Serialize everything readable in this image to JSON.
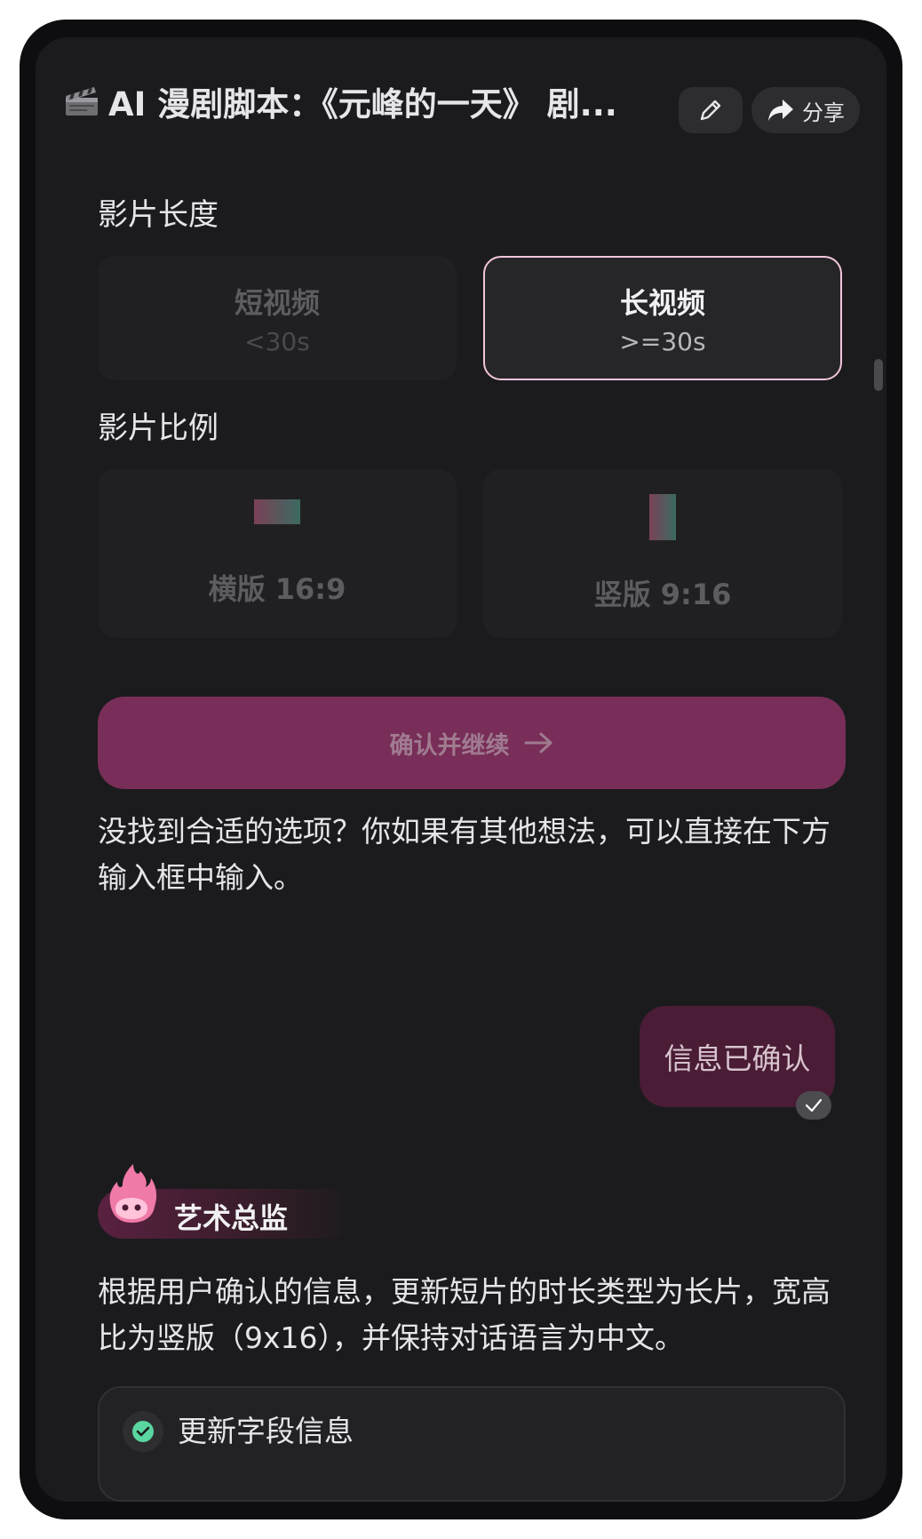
{
  "header": {
    "title": "AI 漫剧脚本：《元峰的一天》 剧...",
    "title_icon": "clapperboard-icon",
    "edit_icon": "pencil-icon",
    "share_label": "分享",
    "share_icon": "share-arrow-icon"
  },
  "length_section": {
    "label": "影片长度",
    "options": [
      {
        "title": "短视频",
        "subtitle": "<30s",
        "selected": false
      },
      {
        "title": "长视频",
        "subtitle": ">=30s",
        "selected": true
      }
    ]
  },
  "ratio_section": {
    "label": "影片比例",
    "options": [
      {
        "label": "横版 16:9",
        "selected": false
      },
      {
        "label": "竖版 9:16",
        "selected": false
      }
    ]
  },
  "confirm_button": {
    "label": "确认并继续",
    "icon": "arrow-right-icon"
  },
  "hint_text": "没找到合适的选项？你如果有其他想法，可以直接在下方输入框中输入。",
  "user_message": {
    "text": "信息已确认",
    "status_icon": "check-icon"
  },
  "agent": {
    "name": "艺术总监",
    "avatar_icon": "flame-mascot-icon",
    "message": "根据用户确认的信息，更新短片的时长类型为长片，宽高比为竖版（9x16），并保持对话语言为中文。",
    "tool_call": {
      "label": "更新字段信息",
      "status": "done"
    }
  },
  "colors": {
    "background": "#1b1b1d",
    "accent": "#782e58",
    "selected_border": "#f2c4dc",
    "user_bubble": "#4a1c35",
    "success": "#5ad6a0"
  }
}
